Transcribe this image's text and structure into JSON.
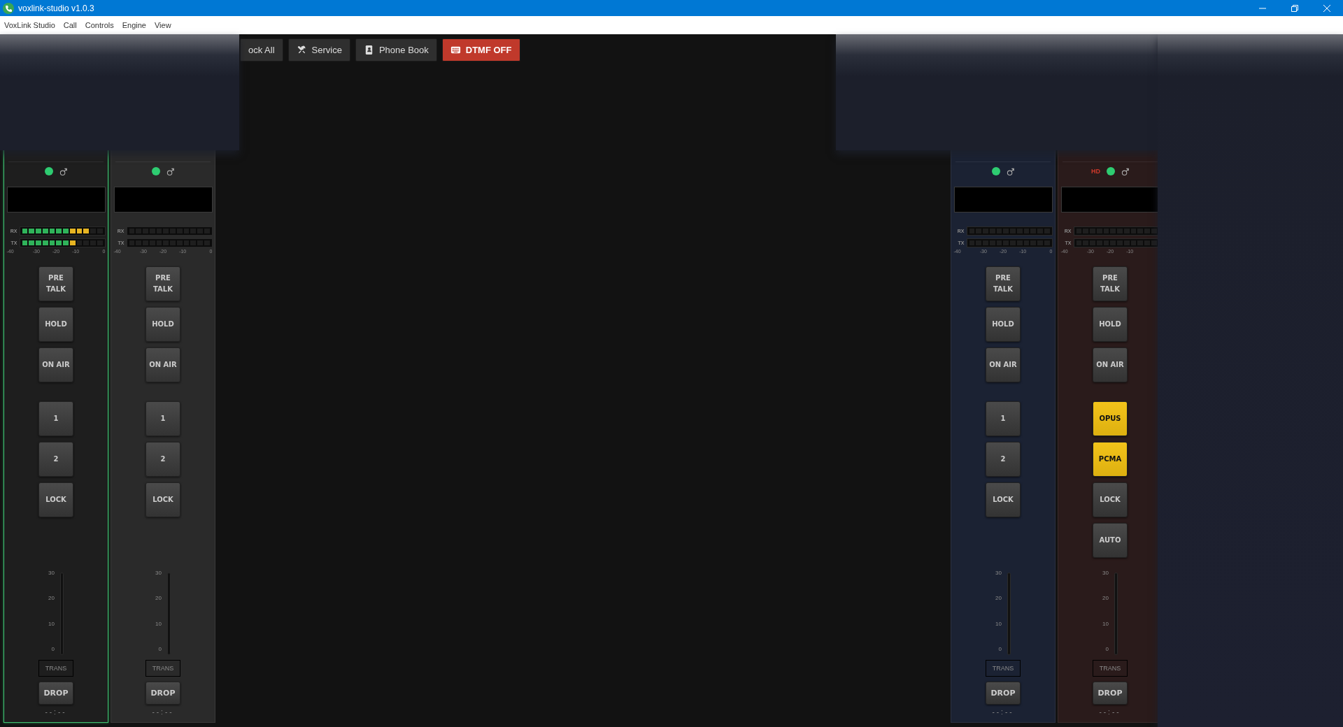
{
  "window": {
    "title": "voxlink-studio v1.0.3"
  },
  "menu": [
    "VoxLink Studio",
    "Call",
    "Controls",
    "Engine",
    "View"
  ],
  "toolbar": [
    {
      "label": "ock All",
      "kind": "plain",
      "alert": false
    },
    {
      "label": "Service",
      "kind": "tools",
      "alert": false
    },
    {
      "label": "Phone Book",
      "kind": "contacts",
      "alert": false
    },
    {
      "label": "DTMF OFF",
      "kind": "keyboard",
      "alert": true
    }
  ],
  "strips": [
    {
      "selected": true,
      "color": "#1e1e1e",
      "online": true,
      "meters": [
        {
          "label": "RX",
          "level": 0.833
        },
        {
          "label": "TX",
          "level": 0.667
        }
      ],
      "scale": [
        "-40",
        "-30",
        "-20",
        "-10",
        "0"
      ],
      "button_groups": [
        [
          {
            "label": "PRE TALK",
            "lit": false
          },
          {
            "label": "HOLD",
            "lit": false
          },
          {
            "label": "ON AIR",
            "lit": false
          }
        ],
        [
          {
            "label": "1",
            "lit": false
          },
          {
            "label": "2",
            "lit": false
          },
          {
            "label": "LOCK",
            "lit": false
          }
        ]
      ],
      "fader_scale": [
        "30",
        "20",
        "10",
        "0"
      ],
      "trans": "TRANS",
      "drop": "DROP",
      "time": "--:--"
    },
    {
      "selected": false,
      "color": "#2a2a2a",
      "online": true,
      "meters": [
        {
          "label": "RX",
          "level": 0
        },
        {
          "label": "TX",
          "level": 0
        }
      ],
      "scale": [
        "-40",
        "-30",
        "-20",
        "-10",
        "0"
      ],
      "button_groups": [
        [
          {
            "label": "PRE TALK",
            "lit": false
          },
          {
            "label": "HOLD",
            "lit": false
          },
          {
            "label": "ON AIR",
            "lit": false
          }
        ],
        [
          {
            "label": "1",
            "lit": false
          },
          {
            "label": "2",
            "lit": false
          },
          {
            "label": "LOCK",
            "lit": false
          }
        ]
      ],
      "fader_scale": [
        "30",
        "20",
        "10",
        "0"
      ],
      "trans": "TRANS",
      "drop": "DROP",
      "time": "--:--"
    },
    {
      "selected": false,
      "color": "#1b2233",
      "online": true,
      "meters": [
        {
          "label": "RX",
          "level": 0
        },
        {
          "label": "TX",
          "level": 0
        }
      ],
      "scale": [
        "-40",
        "-30",
        "-20",
        "-10",
        "0"
      ],
      "button_groups": [
        [
          {
            "label": "PRE TALK",
            "lit": false
          },
          {
            "label": "HOLD",
            "lit": false
          },
          {
            "label": "ON AIR",
            "lit": false
          }
        ],
        [
          {
            "label": "1",
            "lit": false
          },
          {
            "label": "2",
            "lit": false
          },
          {
            "label": "LOCK",
            "lit": false
          }
        ]
      ],
      "fader_scale": [
        "30",
        "20",
        "10",
        "0"
      ],
      "trans": "TRANS",
      "drop": "DROP",
      "time": "--:--"
    },
    {
      "selected": false,
      "color": "#2a1b1b",
      "badge": "HD",
      "online": true,
      "meters": [
        {
          "label": "RX",
          "level": 0
        },
        {
          "label": "TX",
          "level": 0
        }
      ],
      "scale": [
        "-40",
        "-30",
        "-20",
        "-10"
      ],
      "button_groups": [
        [
          {
            "label": "PRE TALK",
            "lit": false
          },
          {
            "label": "HOLD",
            "lit": false
          },
          {
            "label": "ON AIR",
            "lit": false
          }
        ],
        [
          {
            "label": "OPUS",
            "lit": true
          },
          {
            "label": "PCMA",
            "lit": true
          },
          {
            "label": "LOCK",
            "lit": false
          },
          {
            "label": "AUTO",
            "lit": false
          }
        ]
      ],
      "fader_scale": [
        "30",
        "20",
        "10",
        "0"
      ],
      "trans": "TRANS",
      "drop": "DROP",
      "time": "--:--"
    }
  ]
}
